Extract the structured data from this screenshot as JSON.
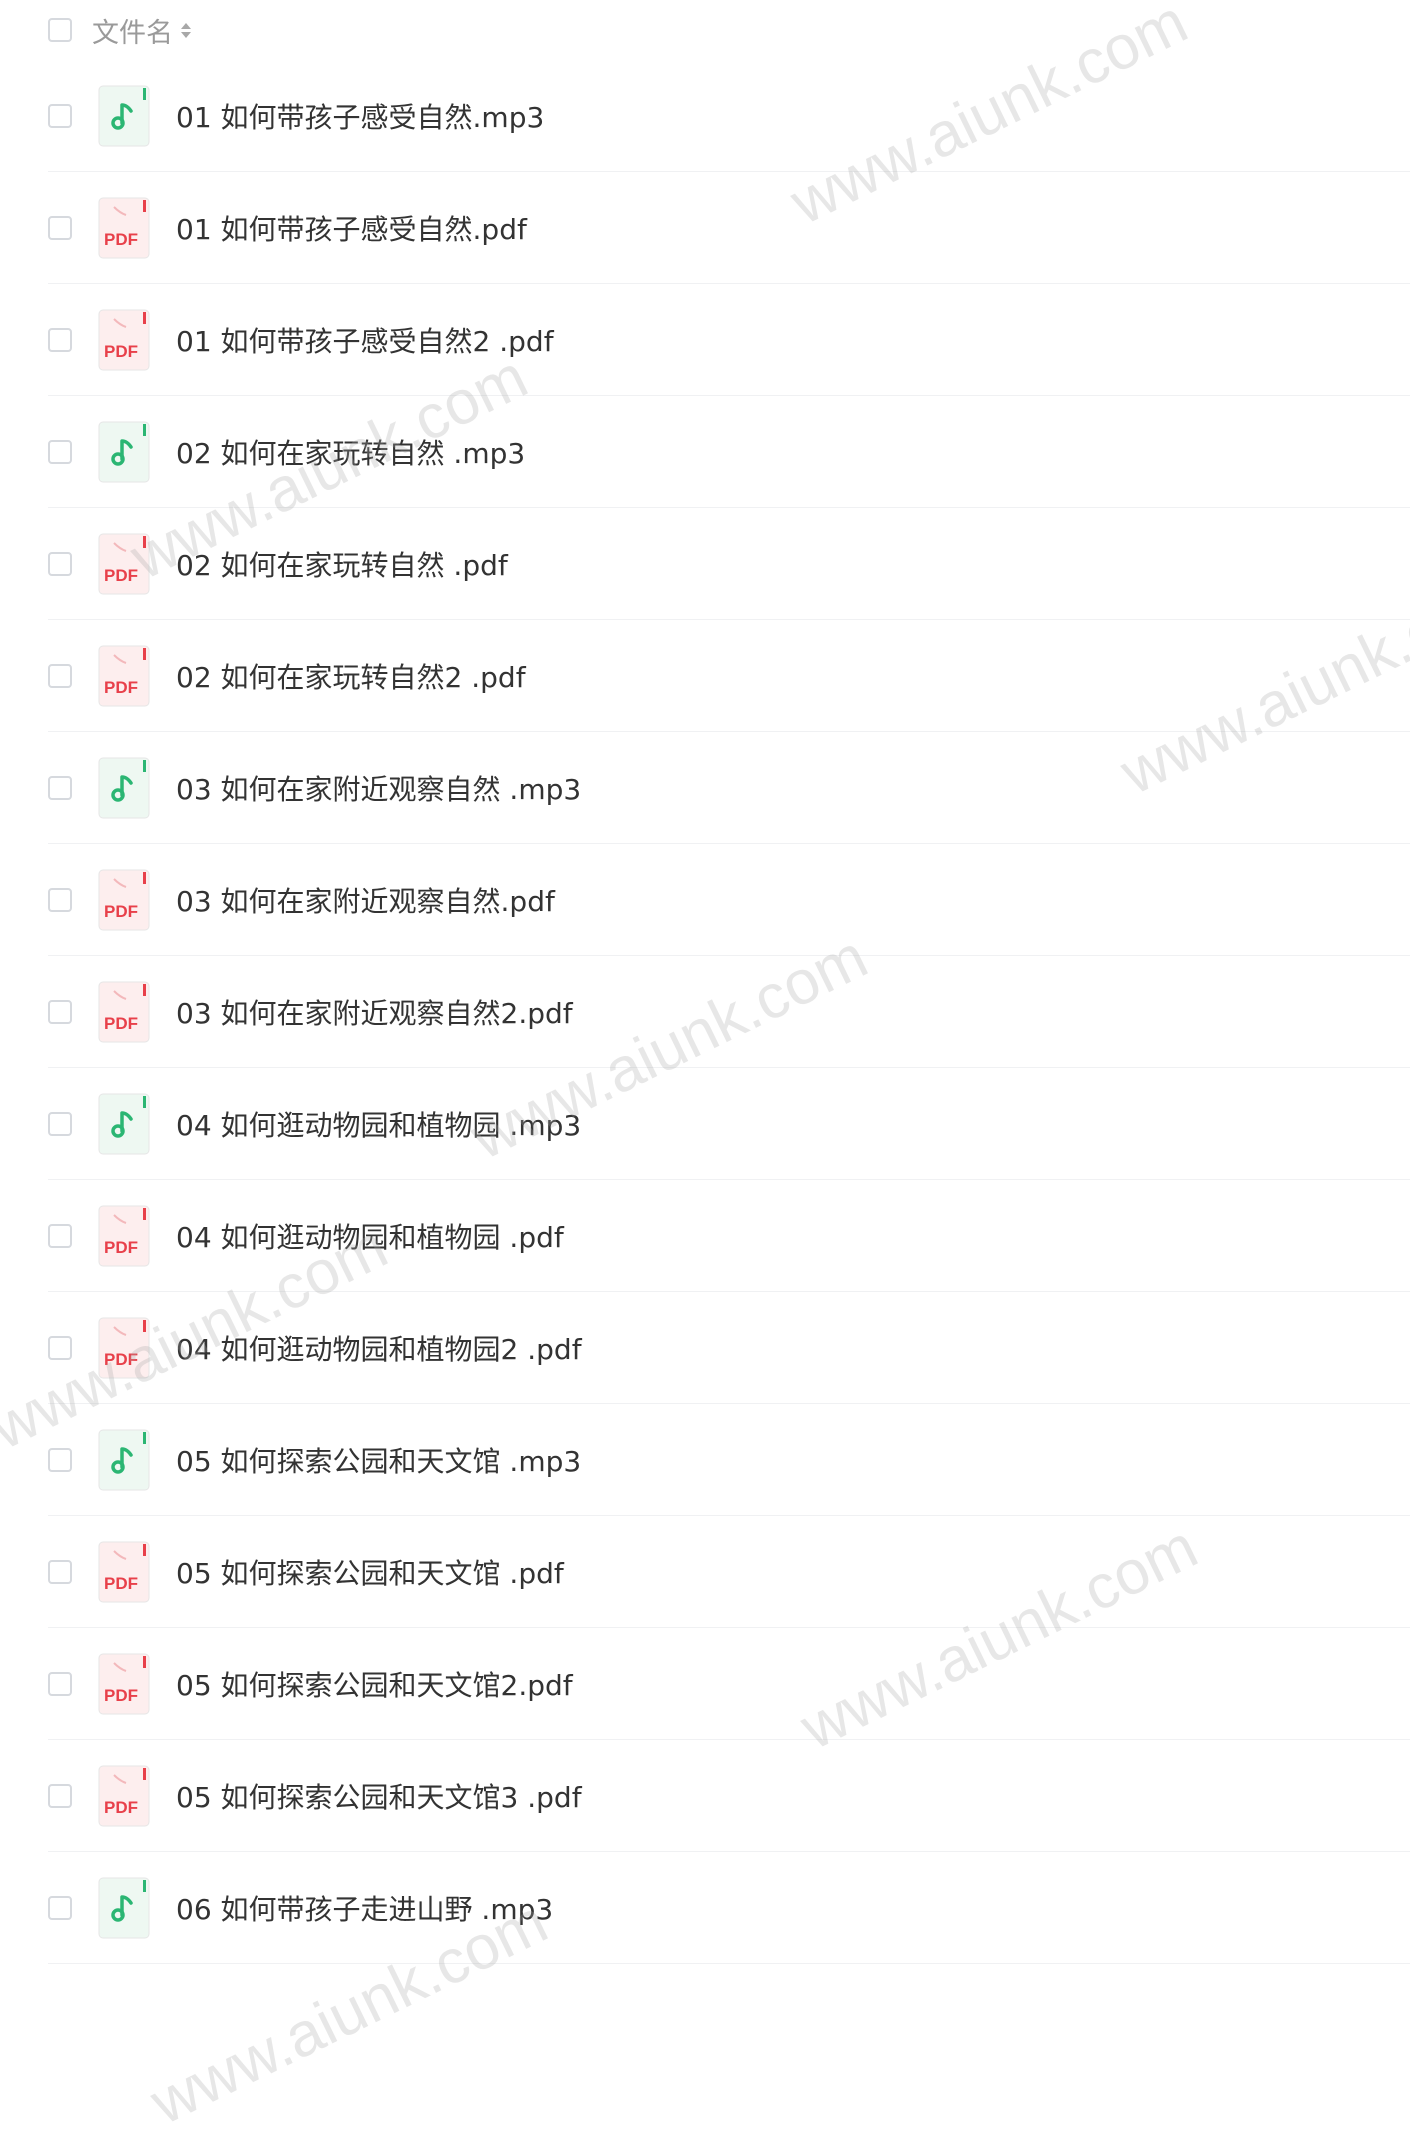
{
  "header": {
    "label": "文件名"
  },
  "colors": {
    "mp3_icon": "#2bb673",
    "pdf_icon": "#e8404a",
    "corner_red": "#e8404a",
    "corner_green": "#2bb673"
  },
  "files": [
    {
      "name": "01 如何带孩子感受自然.mp3",
      "type": "mp3"
    },
    {
      "name": "01 如何带孩子感受自然.pdf",
      "type": "pdf"
    },
    {
      "name": "01 如何带孩子感受自然2 .pdf",
      "type": "pdf"
    },
    {
      "name": "02 如何在家玩转自然 .mp3",
      "type": "mp3"
    },
    {
      "name": "02 如何在家玩转自然 .pdf",
      "type": "pdf"
    },
    {
      "name": "02 如何在家玩转自然2 .pdf",
      "type": "pdf"
    },
    {
      "name": "03 如何在家附近观察自然 .mp3",
      "type": "mp3"
    },
    {
      "name": "03 如何在家附近观察自然.pdf",
      "type": "pdf"
    },
    {
      "name": "03 如何在家附近观察自然2.pdf",
      "type": "pdf"
    },
    {
      "name": "04 如何逛动物园和植物园 .mp3",
      "type": "mp3"
    },
    {
      "name": "04 如何逛动物园和植物园 .pdf",
      "type": "pdf"
    },
    {
      "name": "04 如何逛动物园和植物园2 .pdf",
      "type": "pdf"
    },
    {
      "name": "05 如何探索公园和天文馆 .mp3",
      "type": "mp3"
    },
    {
      "name": "05 如何探索公园和天文馆 .pdf",
      "type": "pdf"
    },
    {
      "name": "05 如何探索公园和天文馆2.pdf",
      "type": "pdf"
    },
    {
      "name": "05 如何探索公园和天文馆3 .pdf",
      "type": "pdf"
    },
    {
      "name": "06 如何带孩子走进山野 .mp3",
      "type": "mp3"
    }
  ],
  "icon_labels": {
    "pdf": "PDF"
  },
  "watermarks": [
    {
      "text": "www.aiunk.com"
    },
    {
      "text": "www.aiunk.com"
    },
    {
      "text": "www.aiunk.com"
    },
    {
      "text": "www.aiunk.com"
    },
    {
      "text": "www.aiunk.com"
    },
    {
      "text": "www.aiunk.com"
    },
    {
      "text": "www.aiunk.com"
    }
  ]
}
